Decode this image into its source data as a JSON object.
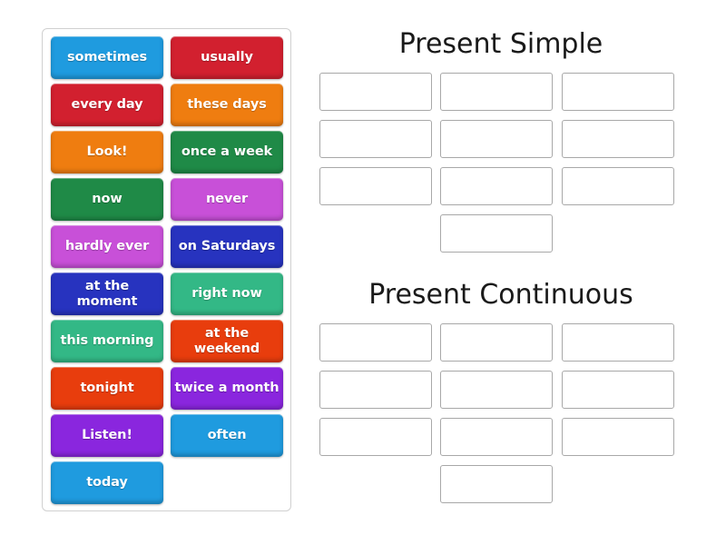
{
  "activity": {
    "source_panel": {
      "tiles": [
        {
          "label": "sometimes",
          "color": "#1f9bdf"
        },
        {
          "label": "usually",
          "color": "#d2202f"
        },
        {
          "label": "every day",
          "color": "#d2202f"
        },
        {
          "label": "these days",
          "color": "#ef7d10"
        },
        {
          "label": "Look!",
          "color": "#ef7d10"
        },
        {
          "label": "once a week",
          "color": "#1f8a47"
        },
        {
          "label": "now",
          "color": "#1f8a47"
        },
        {
          "label": "never",
          "color": "#c850d8"
        },
        {
          "label": "hardly ever",
          "color": "#c850d8"
        },
        {
          "label": "on Saturdays",
          "color": "#2733bf"
        },
        {
          "label": "at the moment",
          "color": "#2733bf"
        },
        {
          "label": "right now",
          "color": "#33b886"
        },
        {
          "label": "this morning",
          "color": "#33b886"
        },
        {
          "label": "at the weekend",
          "color": "#e83d0d"
        },
        {
          "label": "tonight",
          "color": "#e83d0d"
        },
        {
          "label": "twice a month",
          "color": "#8a26de"
        },
        {
          "label": "Listen!",
          "color": "#8a26de"
        },
        {
          "label": "often",
          "color": "#1f9bdf"
        },
        {
          "label": "today",
          "color": "#1f9bdf"
        }
      ]
    },
    "sections": [
      {
        "title": "Present Simple",
        "drop_slots": [
          "",
          "",
          "",
          "",
          "",
          "",
          "",
          "",
          "",
          ""
        ]
      },
      {
        "title": "Present Continuous",
        "drop_slots": [
          "",
          "",
          "",
          "",
          "",
          "",
          "",
          "",
          "",
          ""
        ]
      }
    ]
  }
}
